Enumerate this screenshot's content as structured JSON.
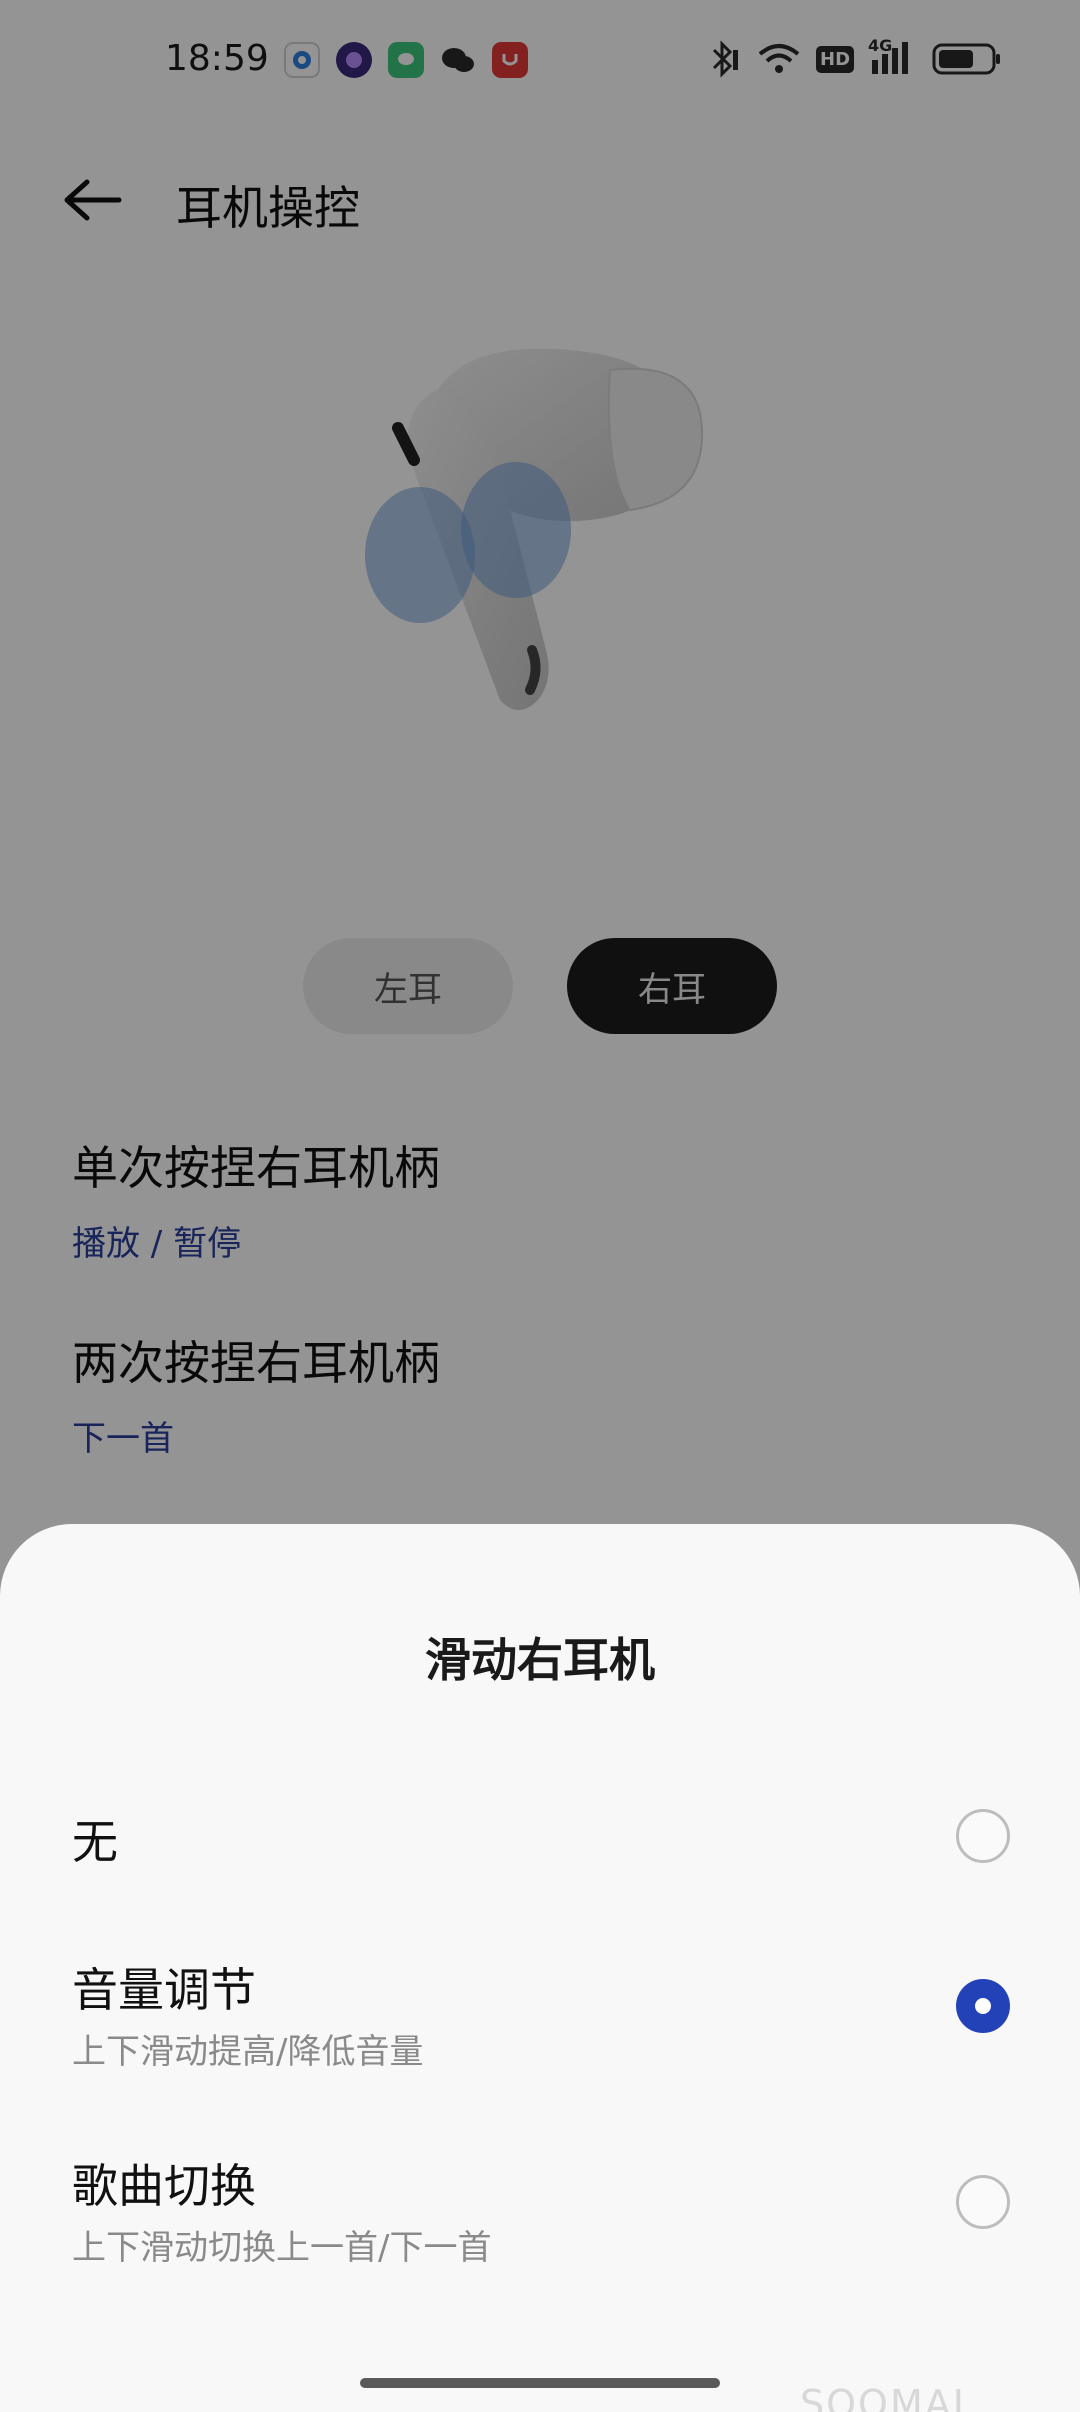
{
  "status_bar": {
    "time": "18:59",
    "apps": [
      {
        "icon": "browser-app-icon",
        "color": "#2f7fe0"
      },
      {
        "icon": "purple-app-icon",
        "color": "#6b3fd0"
      },
      {
        "icon": "messages-app-icon",
        "color": "#3cc77a"
      },
      {
        "icon": "wechat-icon",
        "color": "#ffffff"
      },
      {
        "icon": "store-app-icon",
        "color": "#e23a3a"
      }
    ],
    "system": [
      "bluetooth-icon",
      "wifi-icon",
      "hd-icon",
      "signal-4g-icon",
      "battery-icon"
    ],
    "hd_label": "HD",
    "network_label": "4G"
  },
  "header": {
    "title": "耳机操控"
  },
  "ear_tabs": {
    "left": "左耳",
    "right": "右耳",
    "selected": "右耳"
  },
  "settings": [
    {
      "title": "单次按捏右耳机柄",
      "value": "播放 / 暂停"
    },
    {
      "title": "两次按捏右耳机柄",
      "value": "下一首"
    }
  ],
  "sheet": {
    "title": "滑动右耳机",
    "options": [
      {
        "title": "无",
        "subtitle": "",
        "checked": false
      },
      {
        "title": "音量调节",
        "subtitle": "上下滑动提高/降低音量",
        "checked": true
      },
      {
        "title": "歌曲切换",
        "subtitle": "上下滑动切换上一首/下一首",
        "checked": false
      }
    ]
  },
  "watermark": "SOOMAL",
  "colors": {
    "accent": "#2342b8",
    "link_value": "#2b3f9c"
  }
}
